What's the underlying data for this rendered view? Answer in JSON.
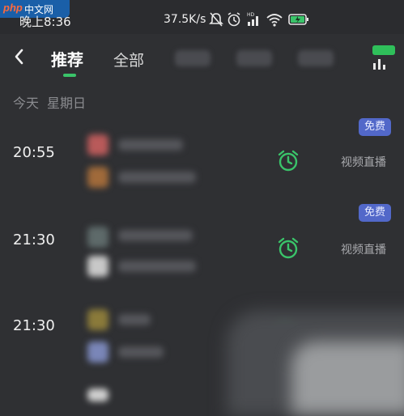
{
  "watermark": {
    "php": "php",
    "cn": "中文网"
  },
  "status_bar": {
    "time": "晚上8:36",
    "network_speed": "37.5K/s",
    "icons": [
      "mute-icon",
      "alarm-icon",
      "hd-signal-icon",
      "wifi-icon",
      "battery-charging-icon"
    ]
  },
  "nav": {
    "tabs": [
      {
        "label": "推荐",
        "selected": true
      },
      {
        "label": "全部",
        "selected": false
      }
    ],
    "accent_color": "#3ac46a"
  },
  "date_header": {
    "day": "今天",
    "weekday": "星期日"
  },
  "schedule": [
    {
      "time": "20:55",
      "badge": "免费",
      "type": "视频直播"
    },
    {
      "time": "21:30",
      "badge": "免费",
      "type": "视频直播"
    },
    {
      "time": "21:30"
    }
  ]
}
